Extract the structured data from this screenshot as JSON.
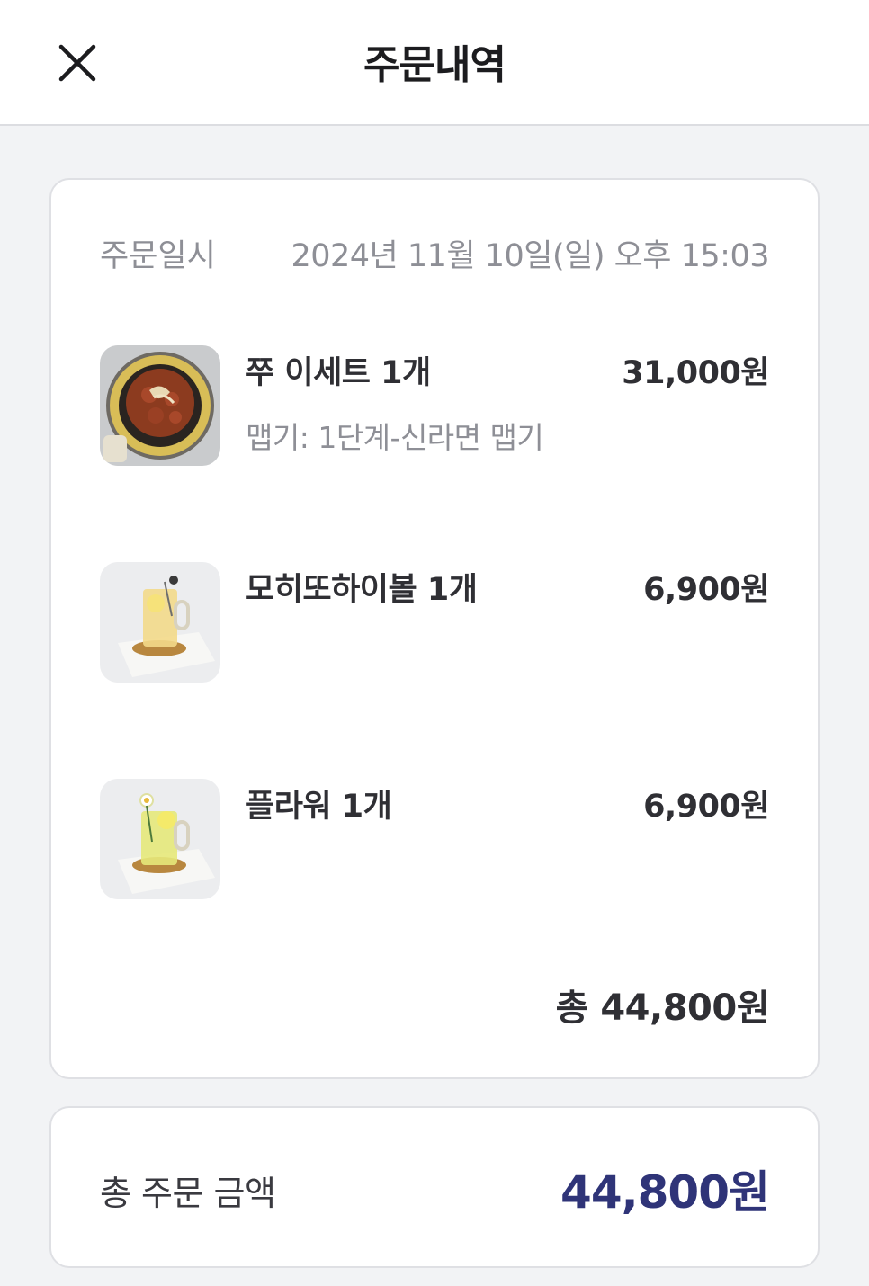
{
  "header": {
    "title": "주문내역",
    "close_icon": "close-icon"
  },
  "order": {
    "date_label": "주문일시",
    "date_value": "2024년 11월 10일(일) 오후 15:03",
    "items": [
      {
        "name": "쭈 이세트 1개",
        "option": "맵기: 1단계-신라면 맵기",
        "price": "31,000원",
        "image": "jjukkumi-set-photo"
      },
      {
        "name": "모히또하이볼 1개",
        "option": "",
        "price": "6,900원",
        "image": "mojito-highball-photo"
      },
      {
        "name": "플라워 1개",
        "option": "",
        "price": "6,900원",
        "image": "flower-drink-photo"
      }
    ],
    "total": "총 44,800원"
  },
  "summary": {
    "label": "총 주문 금액",
    "amount": "44,800원",
    "accent_color": "#2f3478"
  }
}
